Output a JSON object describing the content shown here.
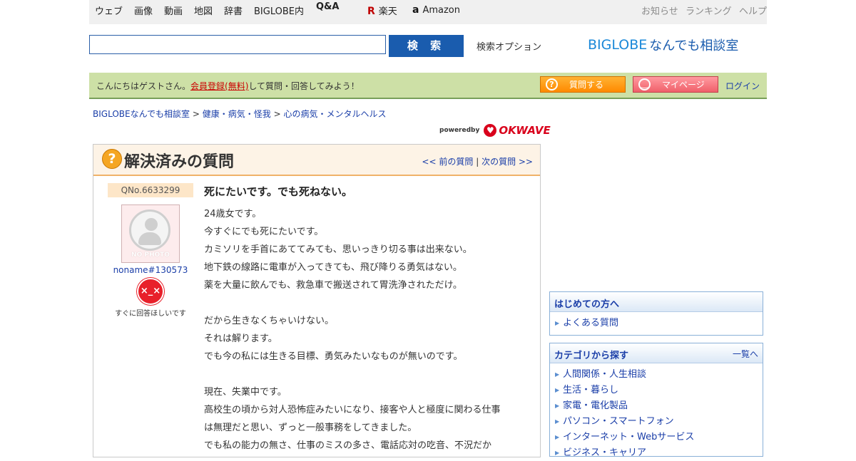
{
  "global_nav": {
    "items": [
      "ウェブ",
      "画像",
      "動画",
      "地図",
      "辞書",
      "BIGLOBE内",
      "Q&A"
    ],
    "active": "Q&A",
    "partners": [
      {
        "icon": "rakuten-icon",
        "label": "楽天"
      },
      {
        "icon": "amazon-icon",
        "label": "Amazon"
      }
    ],
    "right_links": [
      "お知らせ",
      "ランキング",
      "ヘルプ"
    ]
  },
  "search": {
    "value": "",
    "button_label": "検 索",
    "options_link": "検索オプション"
  },
  "logo": {
    "brand": "BIGLOBE",
    "service": "なんでも相談室"
  },
  "guest_bar": {
    "greeting": "こんにちはゲストさん。",
    "register_link": "会員登録(無料)",
    "suffix": "して質問・回答してみよう！",
    "ask_button": "質問する",
    "mypage_button": "マイページ",
    "login": "ログイン"
  },
  "breadcrumb": {
    "items": [
      "BIGLOBEなんでも相談室",
      "健康・病気・怪我",
      "心の病気・メンタルヘルス"
    ],
    "separator": ">"
  },
  "powered_by": {
    "text": "poweredby",
    "brand": "OKWAVE"
  },
  "question_panel": {
    "title": "解決済みの質問",
    "prev": "<< 前の質問",
    "divider": "|",
    "next": "次の質問 >>",
    "qno": "QNo.6633299",
    "no_photo": "NO PHOTO",
    "username": "noname#130573",
    "urgency_label": "すぐに回答ほしいです",
    "question_title": "死にたいです。でも死ねない。",
    "body_lines": [
      "24歳女です。",
      "今すぐにでも死にたいです。",
      "カミソリを手首にあててみても、思いっきり切る事は出来ない。",
      "地下鉄の線路に電車が入ってきても、飛び降りる勇気はない。",
      "薬を大量に飲んでも、救急車で搬送されて胃洗浄されただけ。",
      "",
      "だから生きなくちゃいけない。",
      "それは解ります。",
      "でも今の私には生きる目標、勇気みたいなものが無いのです。",
      "",
      "現在、失業中です。",
      "高校生の頃から対人恐怖症みたいになり、接客や人と極度に関わる仕事",
      "は無理だと思い、ずっと一般事務をしてきました。",
      "でも私の能力の無さ、仕事のミスの多さ、電話応対の吃音、不況だか"
    ]
  },
  "sidebar": {
    "intro": {
      "title": "はじめての方へ",
      "items": [
        "よくある質問"
      ]
    },
    "category": {
      "title": "カテゴリから探す",
      "more": "一覧へ",
      "items": [
        "人間関係・人生相談",
        "生活・暮らし",
        "家電・電化製品",
        "パソコン・スマートフォン",
        "インターネット・Webサービス",
        "ビジネス・キャリア"
      ]
    }
  }
}
